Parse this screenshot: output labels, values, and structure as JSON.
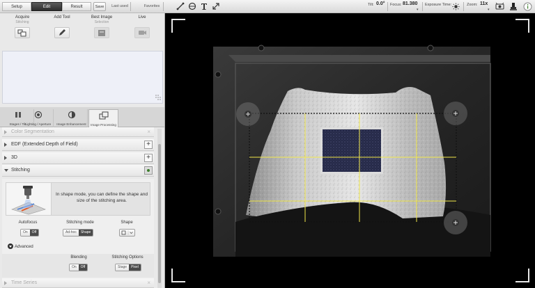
{
  "topbar": {
    "workflow_tabs": [
      "Setup",
      "Edit",
      "Result"
    ],
    "active_tab": "Edit",
    "save_label": "Save",
    "last_used_label": "Last used",
    "favorites_label": "Favorites",
    "tilt_label": "Tilt:",
    "tilt_value": "0.0°",
    "focus_label": "Focus:",
    "focus_value": "81.380",
    "exposure_label": "Exposure Time:",
    "zoom_label": "Zoom:",
    "zoom_value": "11x",
    "tool_icons": [
      "line-measure-icon",
      "circle-measure-icon",
      "text-annotation-icon",
      "resize-arrow-icon"
    ],
    "right_icons": [
      "camera-settings-icon",
      "microscope-icon",
      "info-icon"
    ]
  },
  "tools": [
    {
      "label": "Acquire",
      "sub": "Stitching",
      "icon": "stitching-icon"
    },
    {
      "label": "Add Tool",
      "sub": "",
      "icon": "pen-icon"
    },
    {
      "label": "Best Image",
      "sub": "Selection",
      "icon": "best-image-icon"
    },
    {
      "label": "Live",
      "sub": "",
      "icon": "live-camera-icon"
    }
  ],
  "category_tabs": [
    "Stages / Tilt",
    "Lighting / Aperture",
    "Image Enhancement",
    "Image Processing"
  ],
  "active_category": "Image Processing",
  "sections": {
    "color_segmentation": "Color Segmentation",
    "edf": "EDF (Extended Depth of Field)",
    "three_d": "3D",
    "stitching": "Stitching",
    "time_series": "Time Series"
  },
  "stitching": {
    "info_text": "In shape mode, you can define the shape and size of the stitching area.",
    "autofocus_label": "Autofocus",
    "autofocus_options": [
      "On",
      "Off"
    ],
    "autofocus_selected": "Off",
    "mode_label": "Stitching mode",
    "mode_options": [
      "Ad-hoc",
      "Shape"
    ],
    "mode_selected": "Shape",
    "shape_label": "Shape",
    "advanced_label": "Advanced",
    "blending_label": "Blending",
    "blending_options": [
      "On",
      "Off"
    ],
    "blending_selected": "Off",
    "options_label": "Stitching Options",
    "options": [
      "Stage",
      "Pixel"
    ],
    "options_selected": "Pixel"
  },
  "colors": {
    "accent": "#3b7d2a",
    "grid": "#f2e84a",
    "dark_segment": "#4a4a4a"
  }
}
